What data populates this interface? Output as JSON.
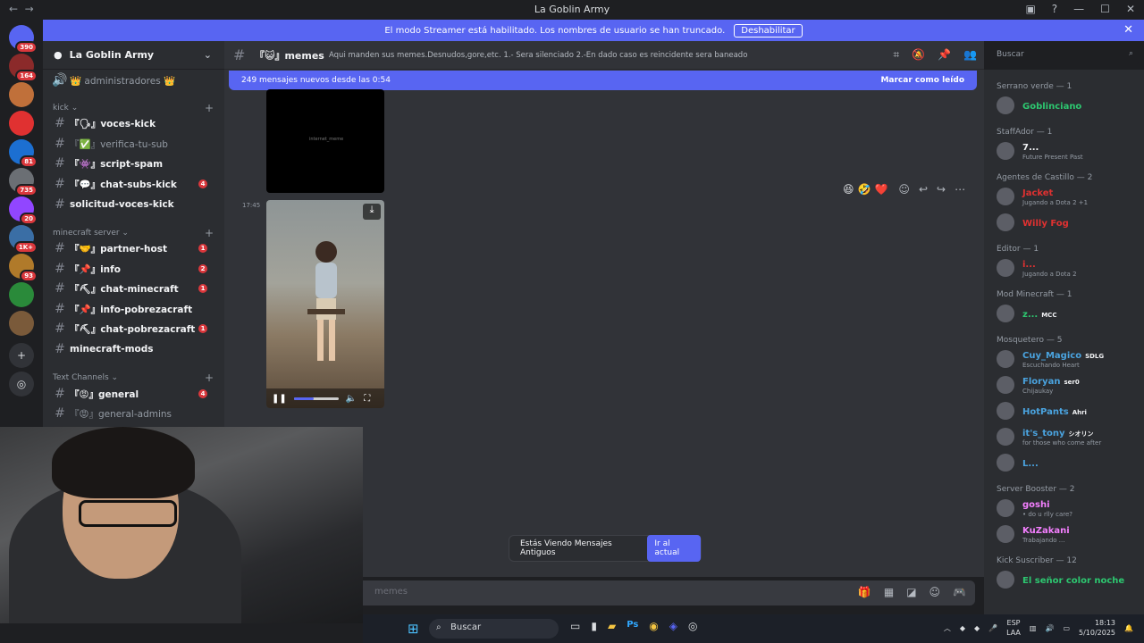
{
  "window": {
    "title": "La Goblin Army"
  },
  "banner": {
    "text": "El modo Streamer está habilitado. Los nombres de usuario se han truncado.",
    "button": "Deshabilitar"
  },
  "servers": [
    {
      "badge": "390",
      "color": "#5865f2"
    },
    {
      "badge": "164",
      "color": "#8b2a2a"
    },
    {
      "badge": "",
      "color": "#c0703a"
    },
    {
      "badge": "",
      "color": "#e03131"
    },
    {
      "badge": "81",
      "color": "#1c6fd1"
    },
    {
      "badge": "735",
      "color": "#6b6f74"
    },
    {
      "badge": "20",
      "color": "#9146ff"
    },
    {
      "badge": "1K+",
      "color": "#3a6ea5"
    },
    {
      "badge": "93",
      "color": "#b07a2a"
    },
    {
      "badge": "",
      "color": "#2a8a3a"
    },
    {
      "badge": "",
      "color": "#7a5a3a"
    }
  ],
  "sidebar": {
    "guild_name": "La Goblin Army",
    "top_channel": "👑 administradores 👑",
    "categories": [
      {
        "label": "kick"
      },
      {
        "label": "minecraft server"
      },
      {
        "label": "Text Channels"
      }
    ],
    "channels": [
      {
        "name": "『🗣』voces-kick",
        "badge": "",
        "dim": false
      },
      {
        "name": "『✅』verifica-tu-sub",
        "badge": "",
        "dim": true
      },
      {
        "name": "『👾』script-spam",
        "badge": "",
        "dim": false
      },
      {
        "name": "『💬』chat-subs-kick",
        "badge": "4",
        "dim": false
      },
      {
        "name": "solicitud-voces-kick",
        "badge": "",
        "dim": false
      },
      {
        "name": "『🤝』partner-host",
        "badge": "1",
        "dim": false
      },
      {
        "name": "『📌』info",
        "badge": "2",
        "dim": false
      },
      {
        "name": "『⛏』chat-minecraft",
        "badge": "1",
        "dim": false
      },
      {
        "name": "『📌』info-pobrezacraft",
        "badge": "",
        "dim": false
      },
      {
        "name": "『⛏』chat-pobrezacraft",
        "badge": "1",
        "dim": false
      },
      {
        "name": "minecraft-mods",
        "badge": "",
        "dim": false
      },
      {
        "name": "『😡』general",
        "badge": "4",
        "dim": false
      },
      {
        "name": "『😡』general-admins",
        "badge": "",
        "dim": true
      }
    ]
  },
  "channel_header": {
    "name": "『😺』memes",
    "topic": "Aqui manden sus memes.Desnudos,gore,etc. 1.- Sera silenciado 2.-En dado caso es reincidente sera baneado"
  },
  "search": {
    "placeholder": "Buscar"
  },
  "new_messages": {
    "text": "249 mensajes nuevos desde las 0:54",
    "mark_read": "Marcar como leído"
  },
  "messages": {
    "video1_label": "internet_meme",
    "time": "17:45",
    "video2_progress": 0.45
  },
  "old_messages": {
    "text": "Estás Viendo Mensajes Antiguos",
    "button": "Ir al actual"
  },
  "composer": {
    "placeholder": "memes"
  },
  "members": {
    "groups": [
      {
        "header": "Serrano verde — 1",
        "items": [
          {
            "name": "Goblinciano",
            "status": "",
            "color": "#2dc770",
            "tag": ""
          }
        ]
      },
      {
        "header": "StaffAdor — 1",
        "items": [
          {
            "name": "7...",
            "status": "Future Present Past",
            "color": "#f2f3f5",
            "tag": ""
          }
        ]
      },
      {
        "header": "Agentes de Castillo — 2",
        "items": [
          {
            "name": "Jacket",
            "status": "Jugando a Dota 2 +1",
            "color": "#e03131",
            "tag": ""
          },
          {
            "name": "Willy Fog",
            "status": "",
            "color": "#e03131",
            "tag": ""
          }
        ]
      },
      {
        "header": "Editor — 1",
        "items": [
          {
            "name": "i...",
            "status": "Jugando a Dota 2",
            "color": "#e03131",
            "tag": ""
          }
        ]
      },
      {
        "header": "Mod Minecraft — 1",
        "items": [
          {
            "name": "z...",
            "status": "",
            "color": "#2dc770",
            "tag": "MCC"
          }
        ]
      },
      {
        "header": "Mosquetero — 5",
        "items": [
          {
            "name": "Cuy_Magico",
            "status": "Escuchando Heart",
            "color": "#4aa3df",
            "tag": "SDLG"
          },
          {
            "name": "Floryan",
            "status": "Chijaukay",
            "color": "#4aa3df",
            "tag": "ser0"
          },
          {
            "name": "HotPants",
            "status": "",
            "color": "#4aa3df",
            "tag": "Ahri"
          },
          {
            "name": "it's_tony",
            "status": "for those who come after",
            "color": "#4aa3df",
            "tag": "シオリン"
          },
          {
            "name": "L...",
            "status": "",
            "color": "#4aa3df",
            "tag": ""
          }
        ]
      },
      {
        "header": "Server Booster — 2",
        "items": [
          {
            "name": "goshi",
            "status": "• do u rlly care?",
            "color": "#f47fff",
            "tag": ""
          },
          {
            "name": "KuZakani",
            "status": "Trabajando ...",
            "color": "#f47fff",
            "tag": ""
          }
        ]
      },
      {
        "header": "Kick Suscriber — 12",
        "items": [
          {
            "name": "El señor color noche",
            "status": "",
            "color": "#2dc770",
            "tag": ""
          }
        ]
      }
    ]
  },
  "taskbar": {
    "search": "Buscar",
    "lang_top": "ESP",
    "lang_bottom": "LAA",
    "time": "18:13",
    "date": "5/10/2025"
  }
}
